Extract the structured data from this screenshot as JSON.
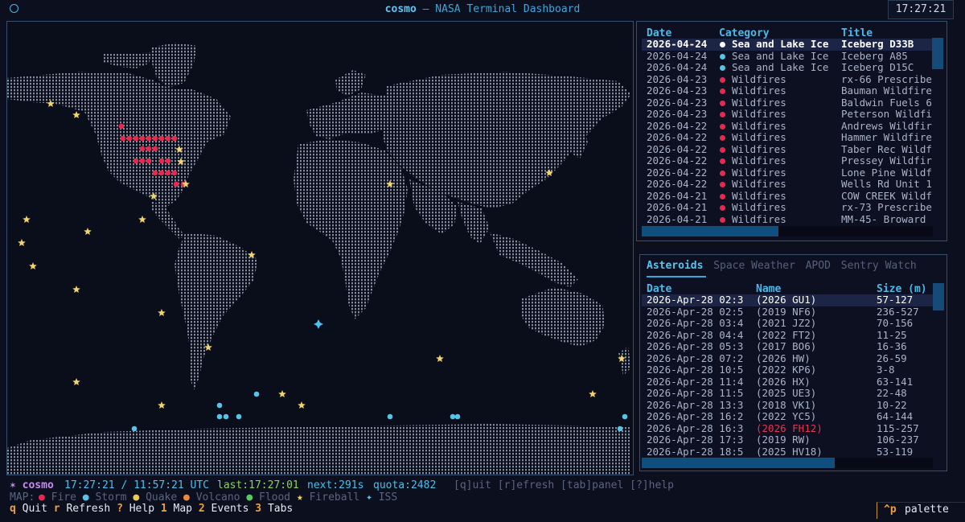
{
  "titlebar": {
    "app": "cosmo",
    "subtitle": "NASA Terminal Dashboard",
    "separator": " – ",
    "clock": "17:27:21"
  },
  "colors": {
    "fire": "#e8294f",
    "storm": "#55c4e6",
    "quake": "#e8c95a",
    "volcano": "#ec8a3c",
    "flood": "#54cc62",
    "fireball": "#f3d36b",
    "iss": "#4cc0f0",
    "accent": "#3fa7d6"
  },
  "map": {
    "fires": [
      [
        150,
        156
      ],
      [
        152,
        171
      ],
      [
        160,
        171
      ],
      [
        168,
        171
      ],
      [
        176,
        171
      ],
      [
        184,
        171
      ],
      [
        192,
        171
      ],
      [
        200,
        171
      ],
      [
        208,
        171
      ],
      [
        216,
        171
      ],
      [
        176,
        184
      ],
      [
        184,
        184
      ],
      [
        192,
        184
      ],
      [
        168,
        199
      ],
      [
        176,
        199
      ],
      [
        184,
        199
      ],
      [
        200,
        199
      ],
      [
        208,
        199
      ],
      [
        192,
        214
      ],
      [
        200,
        214
      ],
      [
        208,
        214
      ],
      [
        216,
        214
      ],
      [
        218,
        228
      ],
      [
        227,
        228
      ]
    ],
    "storms": [
      [
        272,
        503
      ],
      [
        272,
        517
      ],
      [
        280,
        517
      ],
      [
        296,
        517
      ],
      [
        318,
        489
      ],
      [
        166,
        532
      ],
      [
        484,
        517
      ],
      [
        562,
        517
      ],
      [
        568,
        517
      ],
      [
        776,
        517
      ],
      [
        770,
        532
      ]
    ],
    "fireballs": [
      [
        62,
        128
      ],
      [
        94,
        142
      ],
      [
        222,
        185
      ],
      [
        224,
        200
      ],
      [
        230,
        228
      ],
      [
        190,
        243
      ],
      [
        176,
        272
      ],
      [
        32,
        272
      ],
      [
        108,
        287
      ],
      [
        26,
        301
      ],
      [
        40,
        330
      ],
      [
        312,
        316
      ],
      [
        94,
        359
      ],
      [
        200,
        388
      ],
      [
        484,
        228
      ],
      [
        682,
        214
      ],
      [
        258,
        431
      ],
      [
        546,
        445
      ],
      [
        772,
        445
      ],
      [
        94,
        474
      ],
      [
        350,
        489
      ],
      [
        374,
        503
      ],
      [
        200,
        503
      ],
      [
        736,
        489
      ]
    ],
    "iss": [
      395,
      402
    ]
  },
  "events": {
    "headers": {
      "date": "Date",
      "category": "Category",
      "title": "Title"
    },
    "rows": [
      {
        "date": "2026-04-24",
        "category": "Sea and Lake Ice",
        "title": "Iceberg D33B",
        "color": "#ffffff",
        "selected": true
      },
      {
        "date": "2026-04-24",
        "category": "Sea and Lake Ice",
        "title": "Iceberg A85",
        "color": "#55c4e6"
      },
      {
        "date": "2026-04-24",
        "category": "Sea and Lake Ice",
        "title": "Iceberg D15C",
        "color": "#55c4e6"
      },
      {
        "date": "2026-04-23",
        "category": "Wildfires",
        "title": "rx-66 Prescribe",
        "color": "#e8294f"
      },
      {
        "date": "2026-04-23",
        "category": "Wildfires",
        "title": "Bauman Wildfire",
        "color": "#e8294f"
      },
      {
        "date": "2026-04-23",
        "category": "Wildfires",
        "title": "Baldwin Fuels 6",
        "color": "#e8294f"
      },
      {
        "date": "2026-04-23",
        "category": "Wildfires",
        "title": "Peterson Wildfi",
        "color": "#e8294f"
      },
      {
        "date": "2026-04-22",
        "category": "Wildfires",
        "title": "Andrews Wildfir",
        "color": "#e8294f"
      },
      {
        "date": "2026-04-22",
        "category": "Wildfires",
        "title": "Hammer Wildfire",
        "color": "#e8294f"
      },
      {
        "date": "2026-04-22",
        "category": "Wildfires",
        "title": "Taber Rec Wildf",
        "color": "#e8294f"
      },
      {
        "date": "2026-04-22",
        "category": "Wildfires",
        "title": "Pressey Wildfir",
        "color": "#e8294f"
      },
      {
        "date": "2026-04-22",
        "category": "Wildfires",
        "title": "Lone Pine Wildf",
        "color": "#e8294f"
      },
      {
        "date": "2026-04-22",
        "category": "Wildfires",
        "title": "Wells Rd Unit 1",
        "color": "#e8294f"
      },
      {
        "date": "2026-04-21",
        "category": "Wildfires",
        "title": "COW CREEK Wildf",
        "color": "#e8294f"
      },
      {
        "date": "2026-04-21",
        "category": "Wildfires",
        "title": "rx-73 Prescribe",
        "color": "#e8294f"
      },
      {
        "date": "2026-04-21",
        "category": "Wildfires",
        "title": "MM-45- Broward",
        "color": "#e8294f"
      }
    ]
  },
  "tabs": {
    "items": [
      "Asteroids",
      "Space Weather",
      "APOD",
      "Sentry Watch"
    ],
    "active": 0
  },
  "asteroids": {
    "headers": {
      "date": "Date",
      "name": "Name",
      "size": "Size (m)"
    },
    "rows": [
      {
        "date": "2026-Apr-28 02:3",
        "name": "(2026 GU1)",
        "size": "57-127",
        "selected": true
      },
      {
        "date": "2026-Apr-28 02:5",
        "name": "(2019 NF6)",
        "size": "236-527"
      },
      {
        "date": "2026-Apr-28 03:4",
        "name": "(2021 JZ2)",
        "size": "70-156"
      },
      {
        "date": "2026-Apr-28 04:4",
        "name": "(2022 FT2)",
        "size": "11-25"
      },
      {
        "date": "2026-Apr-28 05:3",
        "name": "(2017 BO6)",
        "size": "16-36"
      },
      {
        "date": "2026-Apr-28 07:2",
        "name": "(2026 HW)",
        "size": "26-59"
      },
      {
        "date": "2026-Apr-28 10:5",
        "name": "(2022 KP6)",
        "size": "3-8"
      },
      {
        "date": "2026-Apr-28 11:4",
        "name": "(2026 HX)",
        "size": "63-141"
      },
      {
        "date": "2026-Apr-28 11:5",
        "name": "(2025 UE3)",
        "size": "22-48"
      },
      {
        "date": "2026-Apr-28 13:3",
        "name": "(2018 VK1)",
        "size": "10-22"
      },
      {
        "date": "2026-Apr-28 16:2",
        "name": "(2022 YC5)",
        "size": "64-144"
      },
      {
        "date": "2026-Apr-28 16:3",
        "name": "(2026 FH12)",
        "size": "115-257",
        "hazardous": true
      },
      {
        "date": "2026-Apr-28 17:3",
        "name": "(2019 RW)",
        "size": "106-237"
      },
      {
        "date": "2026-Apr-28 18:5",
        "name": "(2025 HV18)",
        "size": "53-119"
      }
    ]
  },
  "status": {
    "app": "cosmo",
    "times": "17:27:21 / 11:57:21 UTC",
    "last": "last:17:27:01",
    "next": "next:291s",
    "quota": "quota:2482",
    "hints": "[q]uit [r]efresh [tab]panel [?]help"
  },
  "legend": {
    "label": "MAP:",
    "items": [
      {
        "name": "Fire",
        "color": "#e8294f",
        "glyph": "●"
      },
      {
        "name": "Storm",
        "color": "#55c4e6",
        "glyph": "●"
      },
      {
        "name": "Quake",
        "color": "#e8c95a",
        "glyph": "●"
      },
      {
        "name": "Volcano",
        "color": "#ec8a3c",
        "glyph": "●"
      },
      {
        "name": "Flood",
        "color": "#54cc62",
        "glyph": "●"
      },
      {
        "name": "Fireball",
        "color": "#f3d36b",
        "glyph": "★"
      },
      {
        "name": "ISS",
        "color": "#4cc0f0",
        "glyph": "✦"
      }
    ]
  },
  "shortcuts": [
    {
      "key": "q",
      "label": "Quit"
    },
    {
      "key": "r",
      "label": "Refresh"
    },
    {
      "key": "?",
      "label": "Help"
    },
    {
      "key": "1",
      "label": "Map"
    },
    {
      "key": "2",
      "label": "Events"
    },
    {
      "key": "3",
      "label": "Tabs"
    }
  ],
  "palette": {
    "key": "^p",
    "label": "palette"
  }
}
